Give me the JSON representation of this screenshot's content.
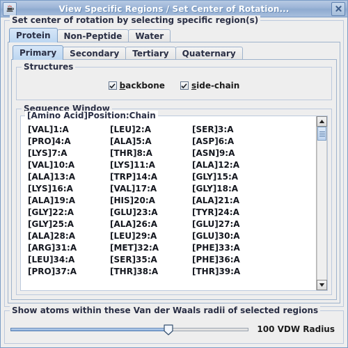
{
  "window": {
    "title": "View Specific Regions / Set Center of Rotation...",
    "app_icon": "java-coffee-cup-icon",
    "close_icon": "close-icon"
  },
  "outer_group": {
    "title": "Set center of rotation by selecting specific region(s)"
  },
  "primary_tabs": {
    "selected": "Protein",
    "items": [
      {
        "label": "Protein"
      },
      {
        "label": "Non-Peptide"
      },
      {
        "label": "Water"
      }
    ]
  },
  "secondary_tabs": {
    "selected": "Primary",
    "items": [
      {
        "label": "Primary"
      },
      {
        "label": "Secondary"
      },
      {
        "label": "Tertiary"
      },
      {
        "label": "Quaternary"
      }
    ]
  },
  "structures": {
    "title": "Structures",
    "checkboxes": [
      {
        "label": "backbone",
        "mnemonic": "b",
        "rest": "ackbone",
        "checked": true
      },
      {
        "label": "side-chain",
        "mnemonic": "s",
        "rest": "ide-chain",
        "checked": true
      }
    ]
  },
  "sequence_window": {
    "title": "Sequence Window",
    "list_header": "[Amino Acid]Position:Chain",
    "rows": [
      [
        "[VAL]1:A",
        "[LEU]2:A",
        "[SER]3:A"
      ],
      [
        "[PRO]4:A",
        "[ALA]5:A",
        "[ASP]6:A"
      ],
      [
        "[LYS]7:A",
        "[THR]8:A",
        "[ASN]9:A"
      ],
      [
        "[VAL]10:A",
        "[LYS]11:A",
        "[ALA]12:A"
      ],
      [
        "[ALA]13:A",
        "[TRP]14:A",
        "[GLY]15:A"
      ],
      [
        "[LYS]16:A",
        "[VAL]17:A",
        "[GLY]18:A"
      ],
      [
        "[ALA]19:A",
        "[HIS]20:A",
        "[ALA]21:A"
      ],
      [
        "[GLY]22:A",
        "[GLU]23:A",
        "[TYR]24:A"
      ],
      [
        "[GLY]25:A",
        "[ALA]26:A",
        "[GLU]27:A"
      ],
      [
        "[ALA]28:A",
        "[LEU]29:A",
        "[GLU]30:A"
      ],
      [
        "[ARG]31:A",
        "[MET]32:A",
        "[PHE]33:A"
      ],
      [
        "[LEU]34:A",
        "[SER]35:A",
        "[PHE]36:A"
      ],
      [
        "[PRO]37:A",
        "[THR]38:A",
        "[THR]39:A"
      ]
    ],
    "scrollbar": {
      "up_icon": "scroll-up-arrow-icon",
      "down_icon": "scroll-down-arrow-icon"
    }
  },
  "vdw": {
    "title": "Show atoms within these Van der Waals radii of selected regions",
    "slider_value": 100,
    "value_label": "100  VDW Radius"
  },
  "colors": {
    "titlebar_accent": "#9fb7d8",
    "panel_bg": "#eeeeee",
    "selected_tab": "#c6dcf3",
    "list_bg": "#ffffff",
    "border": "#bcc9dd",
    "text": "#14171f"
  }
}
